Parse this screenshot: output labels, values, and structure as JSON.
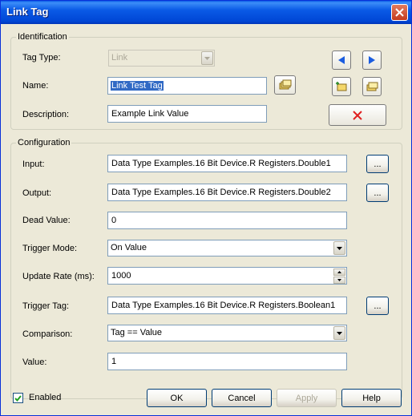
{
  "window": {
    "title": "Link Tag"
  },
  "identification": {
    "legend": "Identification",
    "tag_type": {
      "label": "Tag Type:",
      "value": "Link"
    },
    "name": {
      "label": "Name:",
      "value": "Link Test Tag"
    },
    "description": {
      "label": "Description:",
      "value": "Example Link Value"
    }
  },
  "configuration": {
    "legend": "Configuration",
    "input": {
      "label": "Input:",
      "value": "Data Type Examples.16 Bit Device.R Registers.Double1",
      "browse": "..."
    },
    "output": {
      "label": "Output:",
      "value": "Data Type Examples.16 Bit Device.R Registers.Double2",
      "browse": "..."
    },
    "dead_value": {
      "label": "Dead Value:",
      "value": "0"
    },
    "trigger_mode": {
      "label": "Trigger Mode:",
      "value": "On Value"
    },
    "update_rate": {
      "label": "Update Rate (ms):",
      "value": "1000"
    },
    "trigger_tag": {
      "label": "Trigger Tag:",
      "value": "Data Type Examples.16 Bit Device.R Registers.Boolean1",
      "browse": "..."
    },
    "comparison": {
      "label": "Comparison:",
      "value": "Tag == Value"
    },
    "value": {
      "label": "Value:",
      "value": "1"
    }
  },
  "footer": {
    "enabled_label": "Enabled",
    "enabled_checked": true,
    "ok": "OK",
    "cancel": "Cancel",
    "apply": "Apply",
    "help": "Help"
  },
  "icons": {
    "close": "close-icon",
    "prev": "arrow-left-icon",
    "next": "arrow-right-icon",
    "browse_name": "tag-browse-icon",
    "new_tag": "new-tag-icon",
    "duplicate_tag": "duplicate-tag-icon",
    "delete": "delete-x-icon"
  },
  "colors": {
    "title_bar": "#0a5ae6",
    "nav_arrow": "#1a5ce0",
    "delete_x": "#e02020",
    "selection": "#316ac5"
  }
}
